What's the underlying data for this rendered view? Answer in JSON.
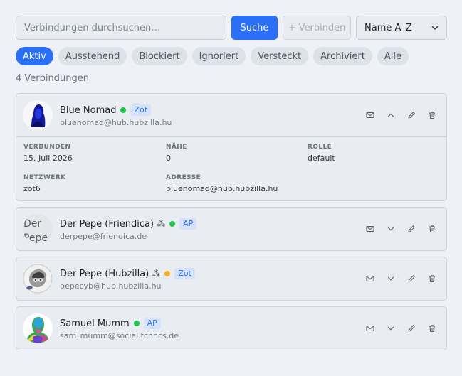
{
  "toolbar": {
    "search_placeholder": "Verbindungen durchsuchen…",
    "search_button": "Suche",
    "connect_button": "+ Verbinden",
    "sort_selected": "Name A–Z"
  },
  "tabs": [
    {
      "label": "Aktiv",
      "active": true
    },
    {
      "label": "Ausstehend",
      "active": false
    },
    {
      "label": "Blockiert",
      "active": false
    },
    {
      "label": "Ignoriert",
      "active": false
    },
    {
      "label": "Versteckt",
      "active": false
    },
    {
      "label": "Archiviert",
      "active": false
    },
    {
      "label": "Alle",
      "active": false
    }
  ],
  "count_label": "4 Verbindungen",
  "connections": [
    {
      "name": "Blue Nomad",
      "status": "online",
      "protocol": "Zot",
      "address": "bluenomad@hub.hubzilla.hu",
      "expanded": true,
      "details": {
        "connected_label": "VERBUNDEN",
        "connected_value": "15. Juli 2026",
        "closeness_label": "NÄHE",
        "closeness_value": "0",
        "role_label": "ROLLE",
        "role_value": "default",
        "network_label": "NETZWERK",
        "network_value": "zot6",
        "address_label": "ADRESSE",
        "address_value": "bluenomad@hub.hubzilla.hu"
      }
    },
    {
      "name": "Der Pepe (Friendica)",
      "symbol": "⁂",
      "status": "online",
      "protocol": "AP",
      "address": "derpepe@friendica.de",
      "avatar_text": "Der Pepe",
      "expanded": false
    },
    {
      "name": "Der Pepe (Hubzilla)",
      "symbol": "⁂",
      "status": "away",
      "protocol": "Zot",
      "address": "pepecyb@hub.hubzilla.hu",
      "expanded": false
    },
    {
      "name": "Samuel Mumm",
      "status": "online",
      "protocol": "AP",
      "address": "sam_mumm@social.tchncs.de",
      "expanded": false
    }
  ],
  "colors": {
    "accent": "#2a6ff5",
    "online": "#1ec84a",
    "away": "#f4b21a",
    "background": "#eef1f7",
    "card": "#e9ecf1"
  },
  "icons": {
    "message": "envelope-icon",
    "collapse": "chevron-up-icon",
    "expand": "chevron-down-icon",
    "edit": "pencil-icon",
    "delete": "trash-icon",
    "sort": "chevron-down-icon"
  }
}
